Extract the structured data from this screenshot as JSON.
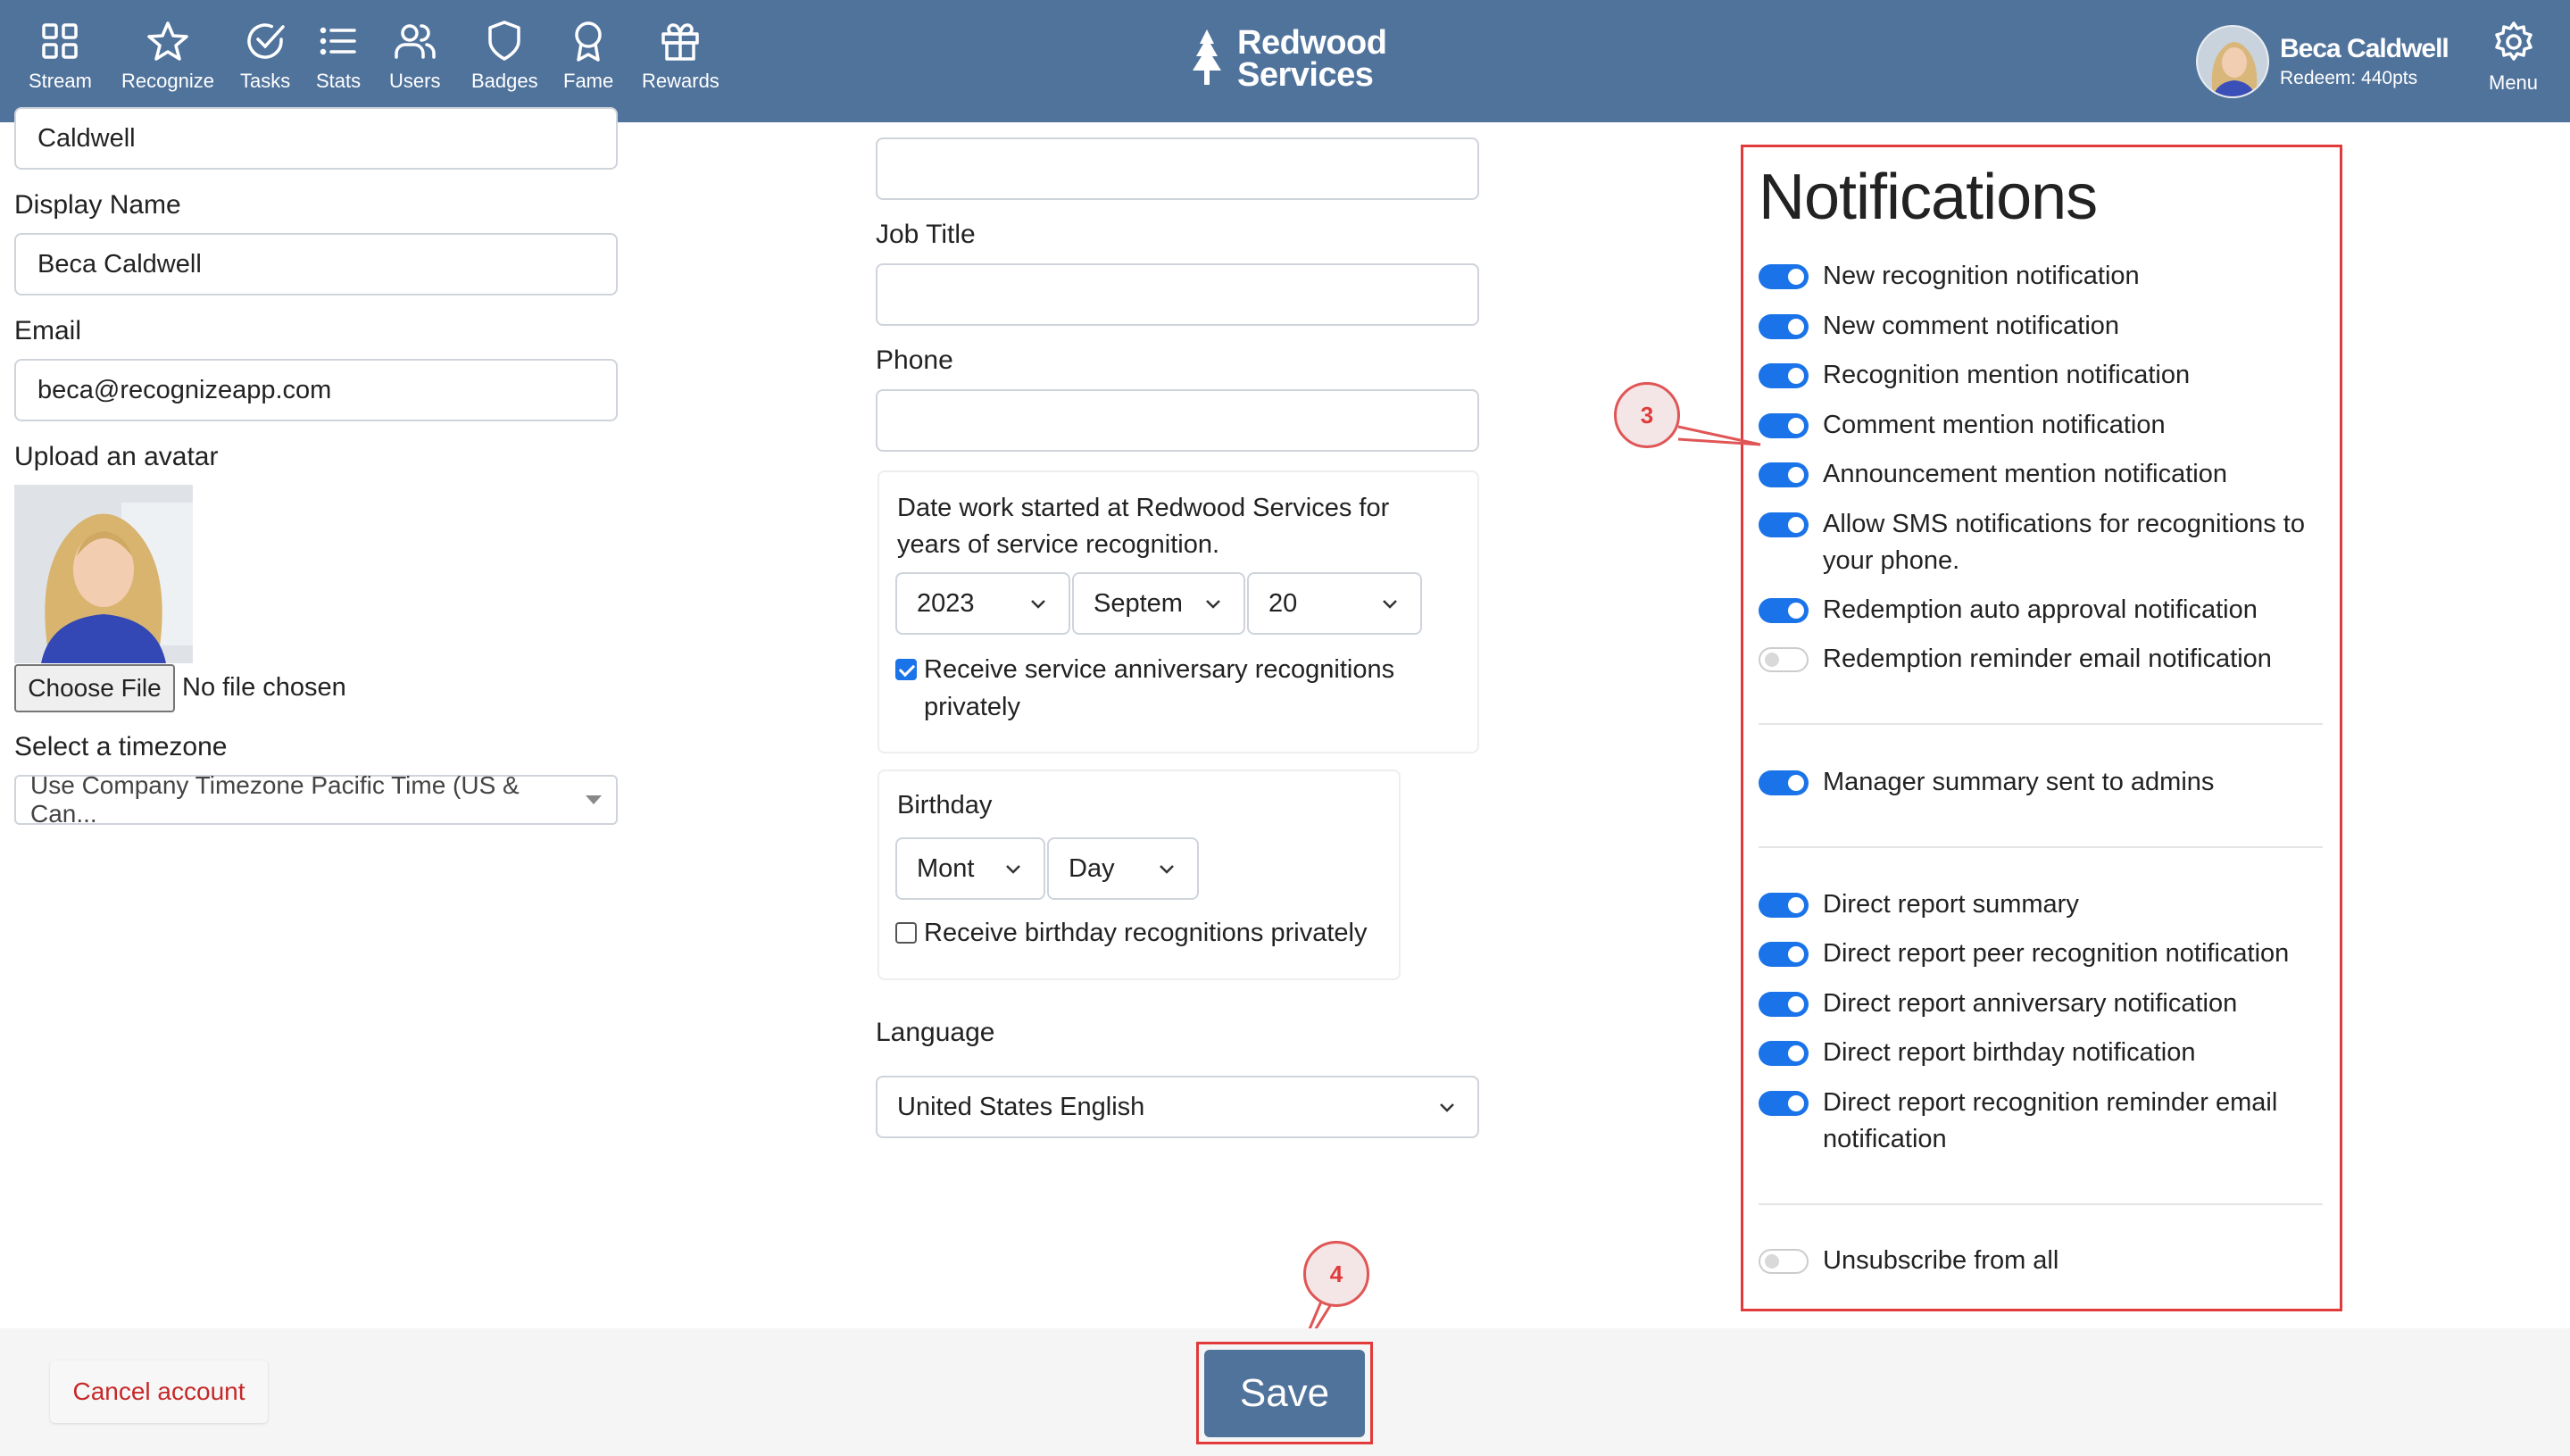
{
  "nav": {
    "items": [
      {
        "label": "Stream",
        "icon": "grid-icon"
      },
      {
        "label": "Recognize",
        "icon": "star-icon"
      },
      {
        "label": "Tasks",
        "icon": "check-circle-icon"
      },
      {
        "label": "Stats",
        "icon": "list-icon"
      },
      {
        "label": "Users",
        "icon": "users-icon"
      },
      {
        "label": "Badges",
        "icon": "shield-icon"
      },
      {
        "label": "Fame",
        "icon": "award-icon"
      },
      {
        "label": "Rewards",
        "icon": "gift-icon"
      }
    ],
    "brand_line1": "Redwood",
    "brand_line2": "Services",
    "user_name": "Beca Caldwell",
    "user_points": "Redeem: 440pts",
    "menu_label": "Menu"
  },
  "profile": {
    "last_name_value": "Caldwell",
    "display_name_label": "Display Name",
    "display_name_value": "Beca Caldwell",
    "email_label": "Email",
    "email_value": "beca@recognizeapp.com",
    "avatar_label": "Upload an avatar",
    "choose_file_label": "Choose File",
    "file_status": "No file chosen",
    "timezone_label": "Select a timezone",
    "timezone_value": "Use Company Timezone Pacific Time (US & Can..."
  },
  "work": {
    "top_field_value": "",
    "job_title_label": "Job Title",
    "job_title_value": "",
    "phone_label": "Phone",
    "phone_value": "",
    "start_date_text": "Date work started at Redwood Services for years of service recognition.",
    "start_year": "2023",
    "start_month": "Septem",
    "start_day": "20",
    "anniversary_private_label": "Receive service anniversary recognitions privately",
    "anniversary_private_checked": true,
    "birthday_label": "Birthday",
    "birthday_month": "Mont",
    "birthday_day": "Day",
    "birthday_private_label": "Receive birthday recognitions privately",
    "birthday_private_checked": false,
    "language_label": "Language",
    "language_value": "United States English"
  },
  "notifications": {
    "title": "Notifications",
    "group1": [
      {
        "label": "New recognition notification",
        "on": true
      },
      {
        "label": "New comment notification",
        "on": true
      },
      {
        "label": "Recognition mention notification",
        "on": true
      },
      {
        "label": "Comment mention notification",
        "on": true
      },
      {
        "label": "Announcement mention notification",
        "on": true
      },
      {
        "label": "Allow SMS notifications for recognitions to your phone.",
        "on": true
      },
      {
        "label": "Redemption auto approval notification",
        "on": true
      },
      {
        "label": "Redemption reminder email notification",
        "on": false
      }
    ],
    "group2": [
      {
        "label": "Manager summary sent to admins",
        "on": true
      }
    ],
    "group3": [
      {
        "label": "Direct report summary",
        "on": true
      },
      {
        "label": "Direct report peer recognition notification",
        "on": true
      },
      {
        "label": "Direct report anniversary notification",
        "on": true
      },
      {
        "label": "Direct report birthday notification",
        "on": true
      },
      {
        "label": "Direct report recognition reminder email notification",
        "on": true
      }
    ],
    "group4": [
      {
        "label": "Unsubscribe from all",
        "on": false
      }
    ]
  },
  "callouts": {
    "step3": "3",
    "step4": "4"
  },
  "footer": {
    "cancel_label": "Cancel account",
    "save_label": "Save"
  },
  "colors": {
    "header_bg": "#50739c",
    "toggle_on": "#1a73e8",
    "highlight_red": "#e23a3a",
    "cancel_red": "#c62828"
  }
}
